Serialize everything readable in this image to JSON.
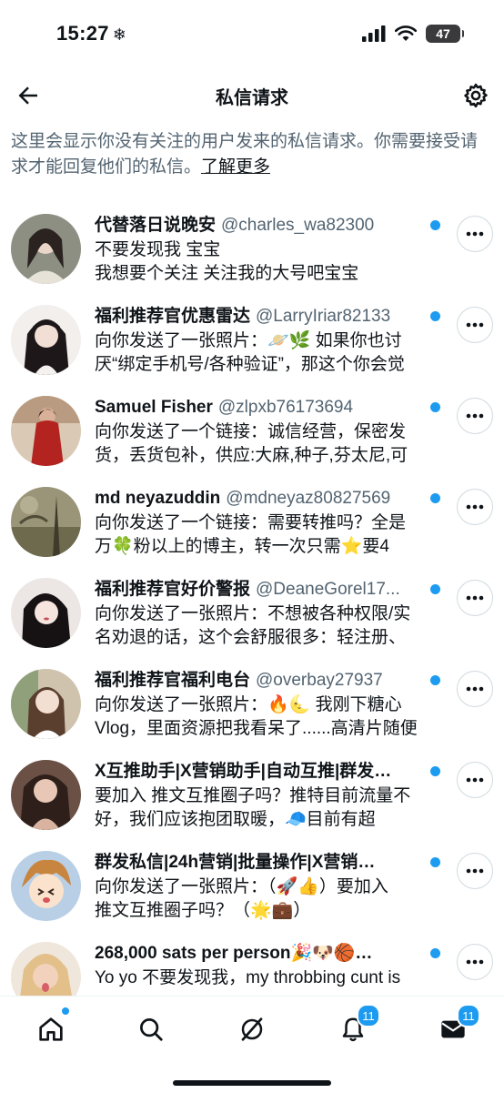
{
  "status": {
    "time": "15:27",
    "battery": "47"
  },
  "header": {
    "title": "私信请求"
  },
  "intro": {
    "text": "这里会显示你没有关注的用户发来的私信请求。你需要接受请求才能回复他们的私信。",
    "link": "了解更多"
  },
  "requests": [
    {
      "name": "代替落日说晚安",
      "handle": "@charles_wa82300",
      "line1": "不要发现我 宝宝",
      "line2": "我想要个关注 关注我的大号吧宝宝"
    },
    {
      "name": "福利推荐官优惠雷达",
      "handle": "@LarryIriar82133",
      "line1": "向你发送了一张照片：🪐🌿 如果你也讨",
      "line2": "厌“绑定手机号/各种验证”，那这个你会觉"
    },
    {
      "name": "Samuel Fisher",
      "handle": "@zlpxb76173694",
      "line1": "向你发送了一个链接：诚信经营，保密发",
      "line2": "货，丢货包补，供应:大麻,种子,芬太尼,可"
    },
    {
      "name": "md neyazuddin",
      "handle": "@mdneyaz80827569",
      "line1": "向你发送了一个链接：需要转推吗？全是",
      "line2": "万🍀粉以上的博主，转一次只需⭐要4"
    },
    {
      "name": "福利推荐官好价警报",
      "handle": "@DeaneGorel17...",
      "line1": "向你发送了一张照片：不想被各种权限/实",
      "line2": "名劝退的话，这个会舒服很多：轻注册、"
    },
    {
      "name": "福利推荐官福利电台",
      "handle": "@overbay27937",
      "line1": "向你发送了一张照片：🔥🌜 我刚下糖心",
      "line2": "Vlog，里面资源把我看呆了......高清片随便"
    },
    {
      "name": "X互推助手|X营销助手|自动互推|群发…",
      "handle": "",
      "line1": "要加入 推文互推圈子吗？推特目前流量不",
      "line2": "好，我们应该抱团取暖，🧢目前有超"
    },
    {
      "name": "群发私信|24h营销|批量操作|X营销…",
      "handle": "",
      "line1": "向你发送了一张照片：（🚀👍）要加入",
      "line2": "推文互推圈子吗？（🌟💼）"
    },
    {
      "name": "268,000 sats per person🎉🐶🏀…",
      "handle": "",
      "line1": "Yo yo 不要发现我，my throbbing cunt is",
      "line2": ""
    }
  ],
  "avatar_colors": [
    "#8c8f82",
    "#2b2426",
    "#8a3b2c",
    "#6f6a52",
    "#2a2326",
    "#c6b8a4",
    "#4a332c",
    "#b8cfe6",
    "#e1c29c"
  ],
  "tabs": {
    "notifications_badge": "11",
    "messages_badge": "11"
  },
  "colors": {
    "accent": "#1d9bf0",
    "secondary_text": "#536471"
  }
}
